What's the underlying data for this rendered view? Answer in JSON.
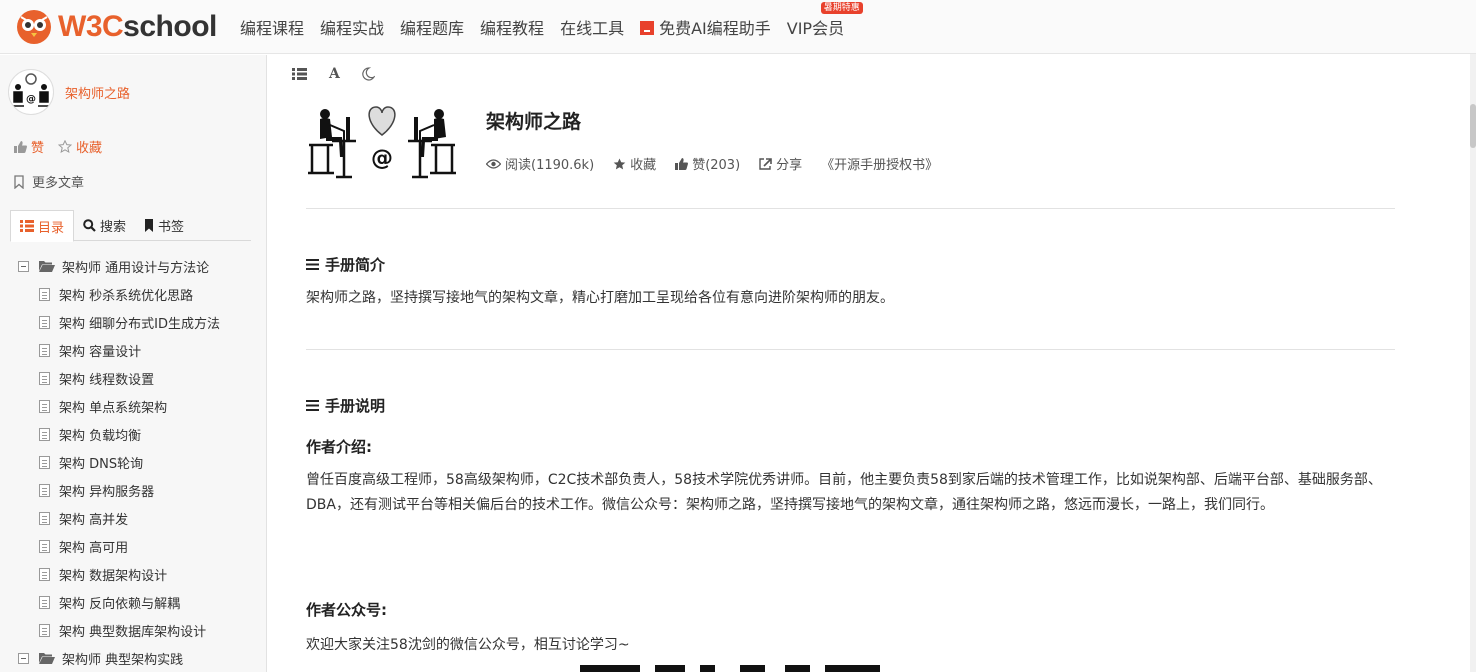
{
  "header": {
    "logo_w3c": "W3C",
    "logo_school": "school",
    "nav": [
      {
        "label": "编程课程"
      },
      {
        "label": "编程实战"
      },
      {
        "label": "编程题库"
      },
      {
        "label": "编程教程"
      },
      {
        "label": "在线工具"
      },
      {
        "label": "免费AI编程助手"
      },
      {
        "label": "VIP会员"
      }
    ],
    "vip_badge": "暑期特惠",
    "brand_color": "#e8612c"
  },
  "sidebar": {
    "author_name": "架构师之路",
    "like_label": "赞",
    "collect_label": "收藏",
    "more_posts_label": "更多文章",
    "tabs": [
      {
        "label": "目录"
      },
      {
        "label": "搜索"
      },
      {
        "label": "书签"
      }
    ],
    "toc": [
      {
        "type": "folder",
        "label": "架构师 通用设计与方法论"
      },
      {
        "type": "page",
        "label": "架构 秒杀系统优化思路"
      },
      {
        "type": "page",
        "label": "架构 细聊分布式ID生成方法"
      },
      {
        "type": "page",
        "label": "架构 容量设计"
      },
      {
        "type": "page",
        "label": "架构 线程数设置"
      },
      {
        "type": "page",
        "label": "架构 单点系统架构"
      },
      {
        "type": "page",
        "label": "架构 负载均衡"
      },
      {
        "type": "page",
        "label": "架构 DNS轮询"
      },
      {
        "type": "page",
        "label": "架构 异构服务器"
      },
      {
        "type": "page",
        "label": "架构 高并发"
      },
      {
        "type": "page",
        "label": "架构 高可用"
      },
      {
        "type": "page",
        "label": "架构 数据架构设计"
      },
      {
        "type": "page",
        "label": "架构 反向依赖与解耦"
      },
      {
        "type": "page",
        "label": "架构 典型数据库架构设计"
      },
      {
        "type": "folder",
        "label": "架构师 典型架构实践"
      }
    ]
  },
  "main": {
    "title": "架构师之路",
    "meta": {
      "read": "阅读(1190.6k)",
      "collect": "收藏",
      "like": "赞(203)",
      "share": "分享",
      "license": "《开源手册授权书》"
    },
    "intro_title": "手册简介",
    "intro_text": "架构师之路，坚持撰写接地气的架构文章，精心打磨加工呈现给各位有意向进阶架构师的朋友。",
    "desc_title": "手册说明",
    "author_intro_title": "作者介绍:",
    "author_intro_text": "曾任百度高级工程师，58高级架构师，C2C技术部负责人，58技术学院优秀讲师。目前，他主要负责58到家后端的技术管理工作，比如说架构部、后端平台部、基础服务部、DBA，还有测试平台等相关偏后台的技术工作。微信公众号：架构师之路，坚持撰写接地气的架构文章，通往架构师之路，悠远而漫长，一路上，我们同行。",
    "account_title": "作者公众号:",
    "account_text": "欢迎大家关注58沈剑的微信公众号，相互讨论学习~"
  }
}
